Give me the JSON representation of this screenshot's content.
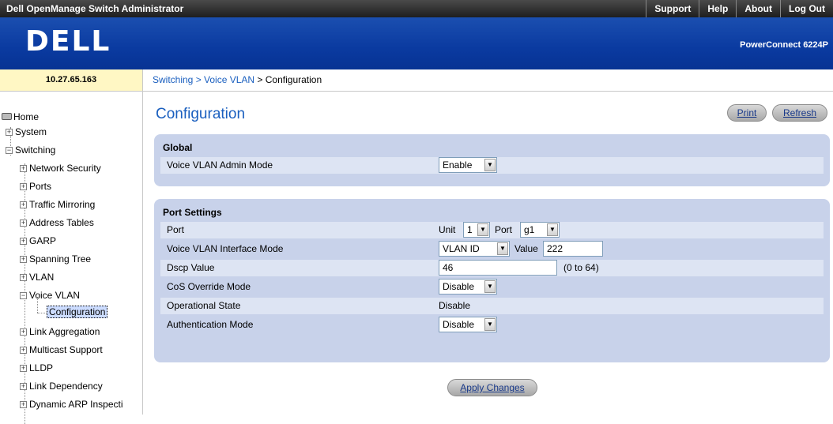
{
  "topbar": {
    "title": "Dell OpenManage Switch Administrator",
    "links": [
      "Support",
      "Help",
      "About",
      "Log Out"
    ]
  },
  "banner": {
    "logo": "DELL",
    "product": "PowerConnect 6224P"
  },
  "ip_address": "10.27.65.163",
  "breadcrumb": {
    "link": "Switching > Voice VLAN",
    "current": " > Configuration"
  },
  "sidebar": {
    "home": "Home",
    "system": "System",
    "switching": "Switching",
    "switching_items": [
      "Network Security",
      "Ports",
      "Traffic Mirroring",
      "Address Tables",
      "GARP",
      "Spanning Tree",
      "VLAN",
      "Voice VLAN"
    ],
    "voice_vlan_child": "Configuration",
    "more_items": [
      "Link Aggregation",
      "Multicast Support",
      "LLDP",
      "Link Dependency",
      "Dynamic ARP Inspecti"
    ]
  },
  "page": {
    "title": "Configuration",
    "print_label": "Print",
    "refresh_label": "Refresh",
    "apply_label": "Apply Changes"
  },
  "global": {
    "title": "Global",
    "admin_mode_label": "Voice VLAN Admin Mode",
    "admin_mode_value": "Enable"
  },
  "port_settings": {
    "title": "Port Settings",
    "port_label": "Port",
    "unit_text": "Unit",
    "unit_value": "1",
    "port_text": "Port",
    "port_value": "g1",
    "interface_mode_label": "Voice VLAN Interface Mode",
    "interface_mode_value": "VLAN ID",
    "value_text": "Value",
    "value_value": "222",
    "dscp_label": "Dscp Value",
    "dscp_value": "46",
    "dscp_range": "(0 to 64)",
    "cos_label": "CoS Override Mode",
    "cos_value": "Disable",
    "op_state_label": "Operational State",
    "op_state_value": "Disable",
    "auth_label": "Authentication Mode",
    "auth_value": "Disable"
  }
}
